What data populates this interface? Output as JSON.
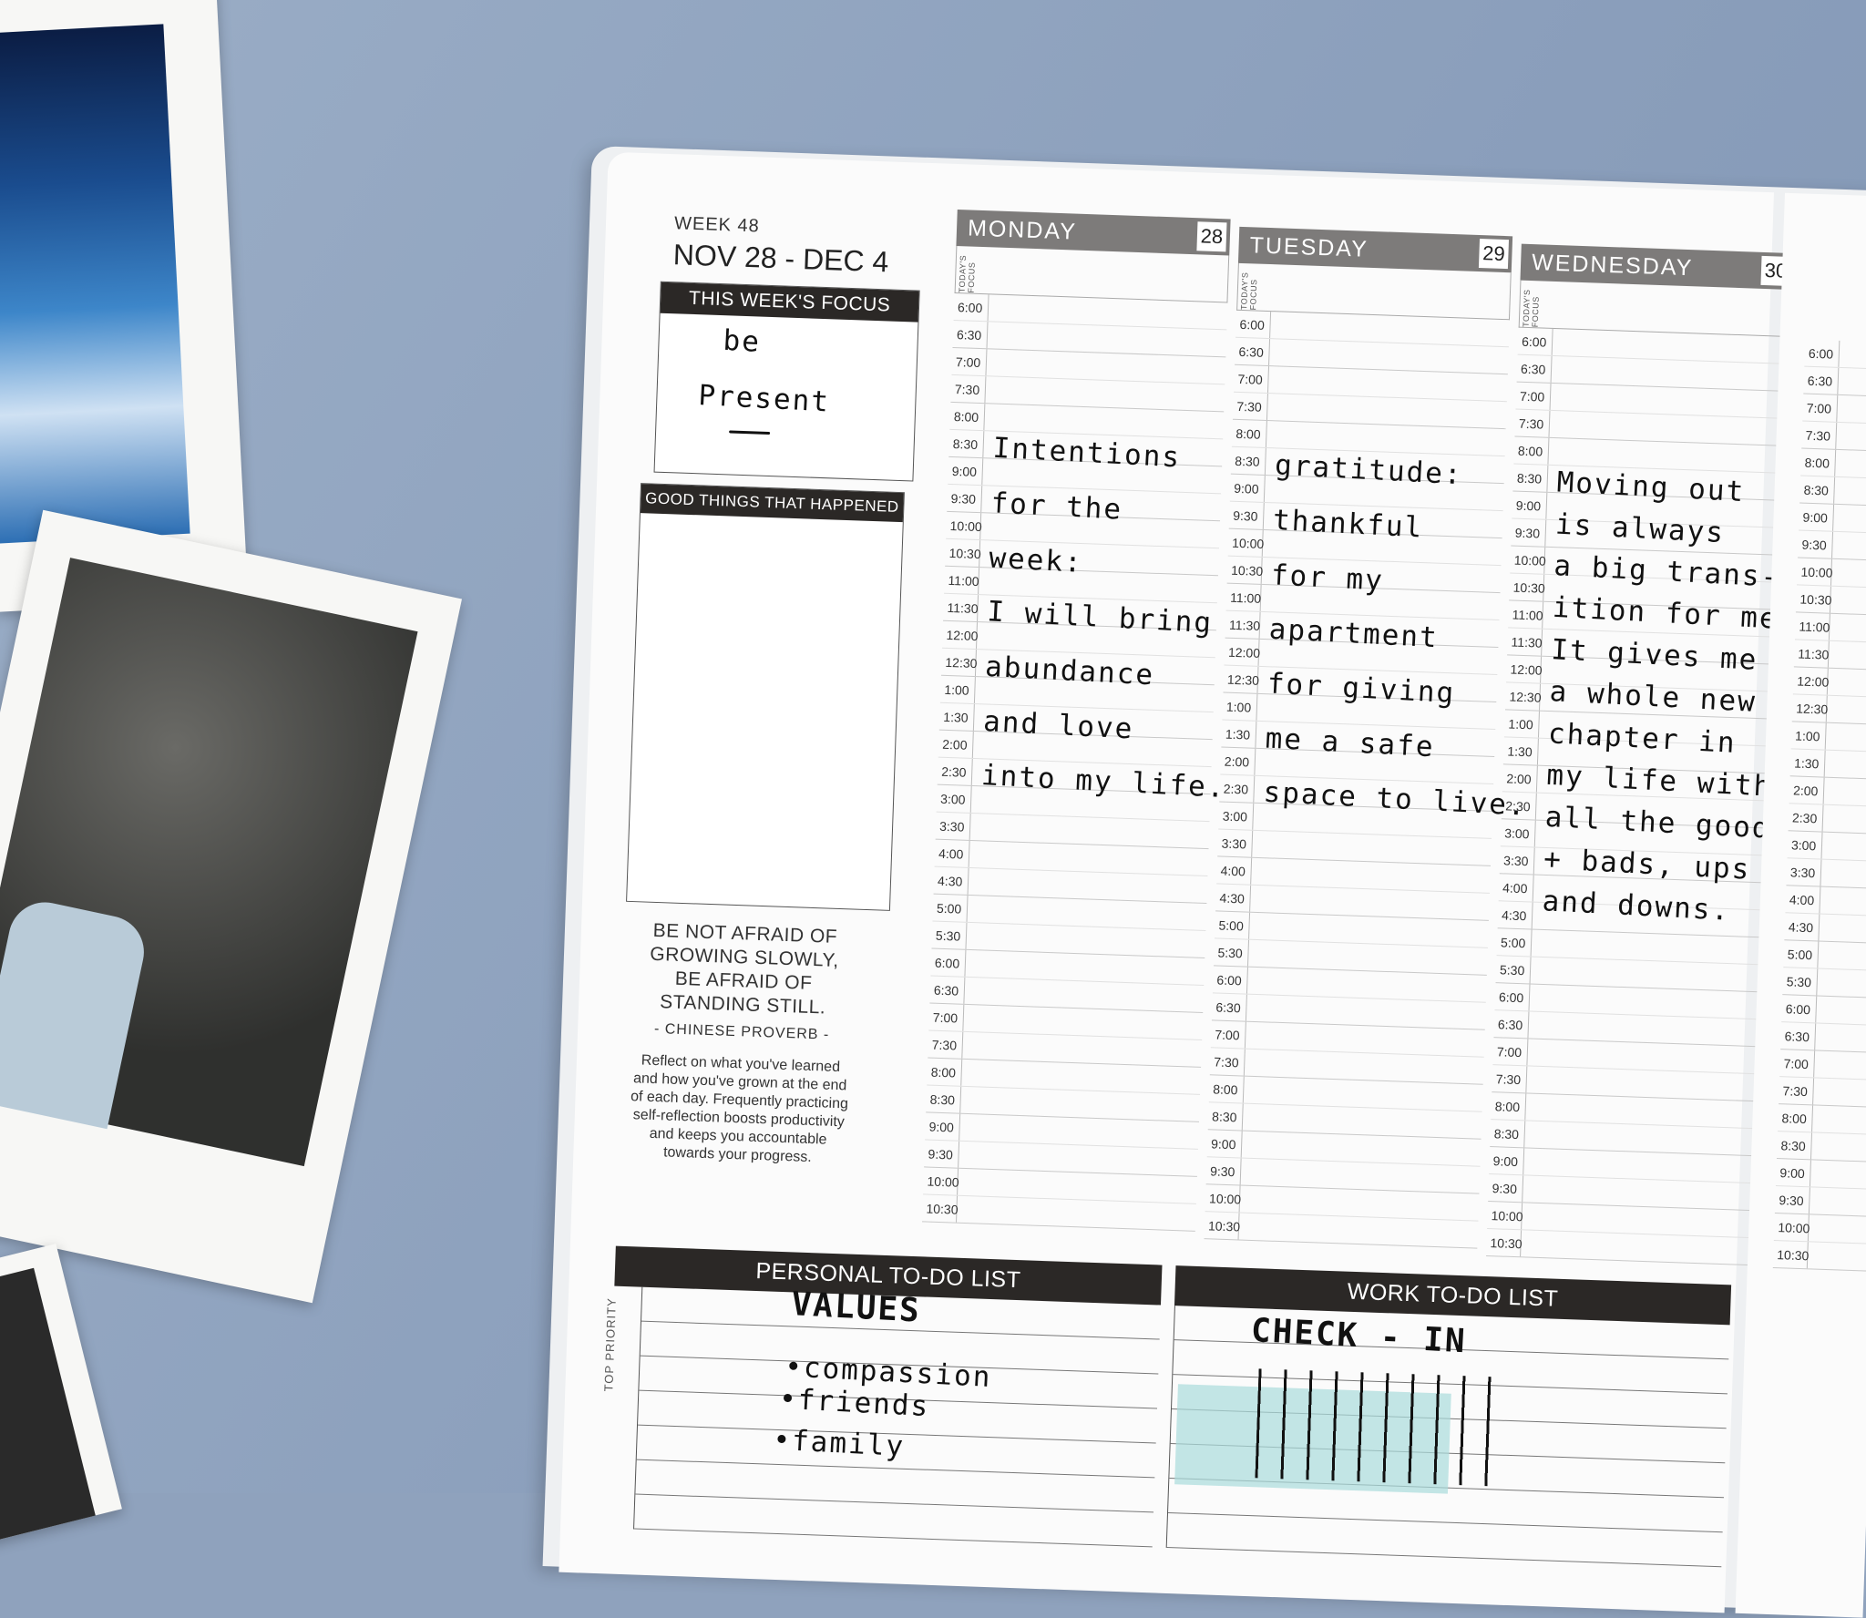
{
  "planner": {
    "week_label": "WEEK 48",
    "date_range": "NOV 28 - DEC 4",
    "focus_title": "THIS WEEK'S FOCUS",
    "focus_hand": [
      "be",
      "Present"
    ],
    "good_things_title": "GOOD THINGS THAT HAPPENED",
    "quote": [
      "BE NOT AFRAID OF",
      "GROWING SLOWLY,",
      "BE AFRAID OF",
      "STANDING STILL."
    ],
    "quote_author": "- CHINESE PROVERB -",
    "reflect_text": "Reflect on what you've learned and how you've grown at the end of each day. Frequently practicing self-reflection boosts productivity and keeps you accountable towards your progress.",
    "today_focus_label": "TODAY'S FOCUS",
    "times": [
      "6:00",
      "6:30",
      "7:00",
      "7:30",
      "8:00",
      "8:30",
      "9:00",
      "9:30",
      "10:00",
      "10:30",
      "11:00",
      "11:30",
      "12:00",
      "12:30",
      "1:00",
      "1:30",
      "2:00",
      "2:30",
      "3:00",
      "3:30",
      "4:00",
      "4:30",
      "5:00",
      "5:30",
      "6:00",
      "6:30",
      "7:00",
      "7:30",
      "8:00",
      "8:30",
      "9:00",
      "9:30",
      "10:00",
      "10:30"
    ],
    "days": [
      {
        "name": "MONDAY",
        "num": "28",
        "notes": [
          "Intentions",
          "for the",
          "week:",
          "I will bring",
          "abundance",
          "and love",
          "into my life."
        ]
      },
      {
        "name": "TUESDAY",
        "num": "29",
        "notes": [
          "gratitude:",
          "thankful",
          "for my",
          "apartment",
          "for giving",
          "me a safe",
          "space to live."
        ]
      },
      {
        "name": "WEDNESDAY",
        "num": "30",
        "notes": [
          "Moving out",
          "is always",
          "a big trans-",
          "ition for me.",
          "It gives me",
          "a whole new",
          "chapter in",
          "my life with",
          "all the good",
          "+ bads, ups",
          "and downs."
        ]
      }
    ],
    "personal_todo": {
      "title": "PERSONAL TO-DO LIST",
      "priority_label": "TOP PRIORITY",
      "hand": [
        "VALUES",
        "•compassion",
        "•friends",
        "•family"
      ]
    },
    "work_todo": {
      "title": "WORK TO-DO LIST",
      "hand": [
        "CHECK - IN"
      ]
    }
  },
  "colors": {
    "background": "#8fa2bd",
    "header_dark": "#2b2826",
    "day_header": "#7d7b7a",
    "highlight": "#a9dcdc"
  }
}
